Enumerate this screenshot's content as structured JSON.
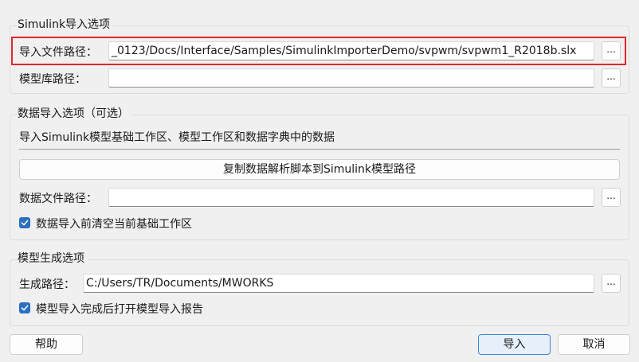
{
  "simulink_group": {
    "title": "Simulink导入选项",
    "import_path_label": "导入文件路径：",
    "import_path_value": "_0123/Docs/Interface/Samples/SimulinkImporterDemo/svpwm/svpwm1_R2018b.slx",
    "library_path_label": "模型库路径：",
    "library_path_value": "",
    "browse_label": "..."
  },
  "data_group": {
    "title": "数据导入选项（可选）",
    "description": "导入Simulink模型基础工作区、模型工作区和数据字典中的数据",
    "copy_script_button": "复制数据解析脚本到Simulink模型路径",
    "data_file_label": "数据文件路径：",
    "data_file_value": "",
    "clear_workspace_label": "数据导入前清空当前基础工作区",
    "clear_workspace_checked": true
  },
  "generate_group": {
    "title": "模型生成选项",
    "output_path_label": "生成路径：",
    "output_path_value": "C:/Users/TR/Documents/MWORKS",
    "open_report_label": "模型导入完成后打开模型导入报告",
    "open_report_checked": true
  },
  "footer": {
    "help_button": "帮助",
    "import_button": "导入",
    "cancel_button": "取消"
  },
  "colors": {
    "highlight": "#e0282e",
    "checkbox": "#2b6fc0",
    "primary_border": "#3b86d6"
  }
}
